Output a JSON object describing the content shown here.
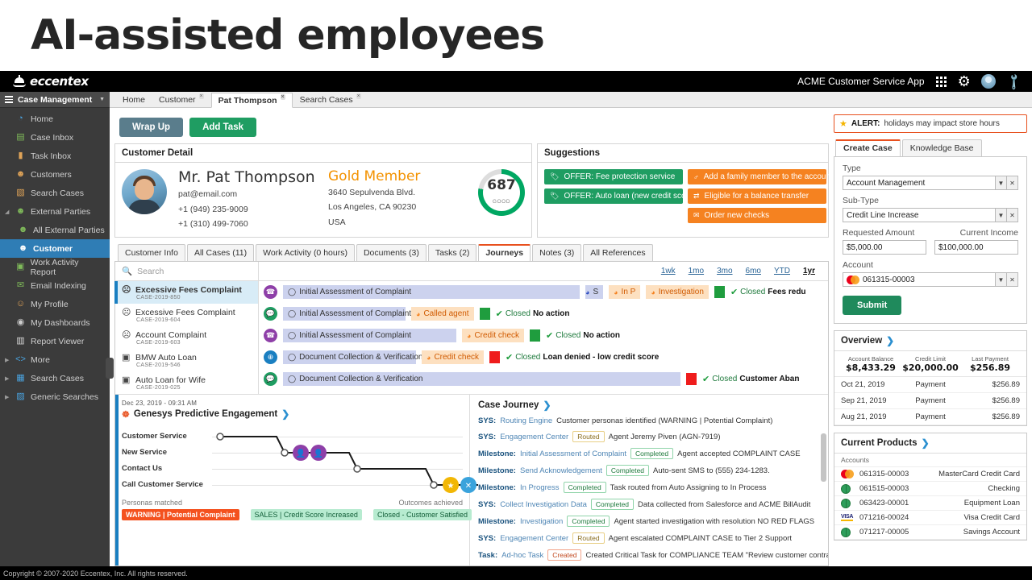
{
  "slide": {
    "title": "AI-assisted employees"
  },
  "topbar": {
    "brand": "eccentex",
    "app_name": "ACME Customer Service App",
    "icons": [
      "apps-grid-icon",
      "gear-icon",
      "avatar-icon",
      "wrench-icon"
    ]
  },
  "sidebar": {
    "header": "Case Management",
    "items": [
      {
        "label": "Home",
        "icon": "home-icon",
        "indent": false,
        "expander": "",
        "active": false
      },
      {
        "label": "Case Inbox",
        "icon": "case-inbox-icon",
        "indent": false,
        "expander": "",
        "active": false
      },
      {
        "label": "Task Inbox",
        "icon": "task-inbox-icon",
        "indent": false,
        "expander": "",
        "active": false
      },
      {
        "label": "Customers",
        "icon": "customers-icon",
        "indent": false,
        "expander": "",
        "active": false
      },
      {
        "label": "Search Cases",
        "icon": "search-cases-icon",
        "indent": false,
        "expander": "",
        "active": false
      },
      {
        "label": "External Parties",
        "icon": "external-parties-icon",
        "indent": false,
        "expander": "collapse-arrow",
        "active": false
      },
      {
        "label": "All External Parties",
        "icon": "external-party-icon",
        "indent": true,
        "expander": "",
        "active": false
      },
      {
        "label": "Customer",
        "icon": "customer-icon",
        "indent": true,
        "expander": "",
        "active": true
      },
      {
        "label": "Work Activity Report",
        "icon": "work-activity-icon",
        "indent": false,
        "expander": "",
        "active": false
      },
      {
        "label": "Email Indexing",
        "icon": "email-icon",
        "indent": false,
        "expander": "",
        "active": false
      },
      {
        "label": "My Profile",
        "icon": "profile-icon",
        "indent": false,
        "expander": "",
        "active": false
      },
      {
        "label": "My Dashboards",
        "icon": "dashboard-icon",
        "indent": false,
        "expander": "",
        "active": false
      },
      {
        "label": "Report Viewer",
        "icon": "report-icon",
        "indent": false,
        "expander": "",
        "active": false
      },
      {
        "label": "More",
        "icon": "code-icon",
        "indent": false,
        "expander": "expand-arrow",
        "active": false
      },
      {
        "label": "Search Cases",
        "icon": "grid-icon",
        "indent": false,
        "expander": "expand-arrow",
        "active": false
      },
      {
        "label": "Generic Searches",
        "icon": "generic-search-icon",
        "indent": false,
        "expander": "expand-arrow",
        "active": false
      }
    ]
  },
  "window_tabs": [
    {
      "label": "Home",
      "closable": false,
      "active": false
    },
    {
      "label": "Customer",
      "closable": true,
      "active": false
    },
    {
      "label": "Pat Thompson",
      "closable": true,
      "active": true
    },
    {
      "label": "Search Cases",
      "closable": true,
      "active": false
    }
  ],
  "actions": {
    "wrap_up": "Wrap Up",
    "add_task": "Add Task"
  },
  "customer_detail": {
    "panel_title": "Customer Detail",
    "name": "Mr. Pat Thompson",
    "email": "pat@email.com",
    "phone1": "+1 (949) 235-9009",
    "phone2": "+1 (310) 499-7060",
    "tier": "Gold Member",
    "address1": "3640 Sepulvenda Blvd.",
    "address2": "Los Angeles, CA 90230",
    "address3": "USA",
    "score": "687",
    "score_label": "GOOD"
  },
  "suggestions": {
    "panel_title": "Suggestions",
    "offers": [
      {
        "label": "OFFER: Fee protection service",
        "icon": "tag-icon"
      },
      {
        "label": "OFFER: Auto loan (new credit score)",
        "icon": "tag-icon"
      }
    ],
    "actions": [
      {
        "label": "Add a family member to the account",
        "icon": "family-icon"
      },
      {
        "label": "Eligible for a balance transfer",
        "icon": "transfer-icon"
      },
      {
        "label": "Order new checks",
        "icon": "envelope-icon"
      }
    ]
  },
  "customer_tabs": [
    {
      "label": "Customer Info",
      "active": false
    },
    {
      "label": "All Cases (11)",
      "active": false
    },
    {
      "label": "Work Activity (0 hours)",
      "active": false
    },
    {
      "label": "Documents (3)",
      "active": false
    },
    {
      "label": "Tasks (2)",
      "active": false
    },
    {
      "label": "Journeys",
      "active": true
    },
    {
      "label": "Notes (3)",
      "active": false
    },
    {
      "label": "All References",
      "active": false
    }
  ],
  "journey": {
    "search_placeholder": "Search",
    "ranges": [
      {
        "label": "1wk",
        "selected": false
      },
      {
        "label": "1mo",
        "selected": false
      },
      {
        "label": "3mo",
        "selected": false
      },
      {
        "label": "6mo",
        "selected": false
      },
      {
        "label": "YTD",
        "selected": false
      },
      {
        "label": "1yr",
        "selected": true
      }
    ],
    "cases": [
      {
        "title": "Excessive Fees Complaint",
        "id": "CASE-2019-850",
        "icon": "sad-face-icon",
        "selected": true
      },
      {
        "title": "Excessive Fees Complaint",
        "id": "CASE-2019-604",
        "icon": "sad-face-icon",
        "selected": false
      },
      {
        "title": "Account Complaint",
        "id": "CASE-2019-603",
        "icon": "sad-face-icon",
        "selected": false
      },
      {
        "title": "BMW Auto Loan",
        "id": "CASE-2019-546",
        "icon": "money-icon",
        "selected": false
      },
      {
        "title": "Auto Loan for Wife",
        "id": "CASE-2019-025",
        "icon": "money-icon",
        "selected": false
      }
    ],
    "tracks": [
      {
        "channel_icon": "phone-icon",
        "channel_color": "#8e3fa8",
        "stage": "Initial Assessment of Complaint",
        "stage_width": 368,
        "mid": [
          {
            "type": "blue-dot",
            "label": "S"
          },
          {
            "type": "peach",
            "label": "In P"
          },
          {
            "type": "peach",
            "label": "Investigation"
          }
        ],
        "square": "green",
        "closed_label": "Closed",
        "closed_value": "Fees redu"
      },
      {
        "channel_icon": "chat-icon",
        "channel_color": "#1f9d62",
        "stage": "Initial Assessment of Complaint",
        "stage_width": 152,
        "mid": [
          {
            "type": "peach",
            "label": "Called agent"
          }
        ],
        "square": "green",
        "closed_label": "Closed",
        "closed_value": "No action"
      },
      {
        "channel_icon": "phone-icon",
        "channel_color": "#8e3fa8",
        "stage": "Initial Assessment of Complaint",
        "stage_width": 215,
        "mid": [
          {
            "type": "peach",
            "label": "Credit check"
          }
        ],
        "square": "green",
        "closed_label": "Closed",
        "closed_value": "No action"
      },
      {
        "channel_icon": "web-icon",
        "channel_color": "#1a7fc1",
        "stage": "Document Collection & Verification",
        "stage_width": 165,
        "mid": [
          {
            "type": "peach",
            "label": "Credit check"
          }
        ],
        "square": "red",
        "closed_label": "Closed",
        "closed_value": "Loan denied - low credit score"
      },
      {
        "channel_icon": "chat-icon",
        "channel_color": "#1f9d62",
        "stage": "Document Collection & Verification",
        "stage_width": 493,
        "mid": [],
        "square": "red",
        "closed_label": "Closed",
        "closed_value": "Customer Aban"
      }
    ]
  },
  "genesys": {
    "date": "Dec 23, 2019 - 09:31 AM",
    "title": "Genesys Predictive Engagement",
    "rows": [
      "Customer Service",
      "New Service",
      "Contact Us",
      "Call Customer Service"
    ],
    "footer_left": "Personas matched",
    "footer_right": "Outcomes achieved",
    "tags": [
      {
        "label": "WARNING | Potential Complaint",
        "kind": "warn"
      },
      {
        "label": "SALES | Credit Score Increased",
        "kind": "sales"
      },
      {
        "label": "Closed - Customer Satisfied",
        "kind": "closed"
      }
    ]
  },
  "case_journey": {
    "title": "Case Journey",
    "entries": [
      {
        "key": "SYS:",
        "source": "Routing Engine",
        "status": "",
        "status_kind": "",
        "text": "Customer personas identified (WARNING | Potential Complaint)"
      },
      {
        "key": "SYS:",
        "source": "Engagement Center",
        "status": "Routed",
        "status_kind": "routed",
        "text": "Agent Jeremy Piven (AGN-7919)"
      },
      {
        "key": "Milestone:",
        "source": "Initial Assessment of Complaint",
        "status": "Completed",
        "status_kind": "completed",
        "text": "Agent accepted COMPLAINT CASE"
      },
      {
        "key": "Milestone:",
        "source": "Send Acknowledgement",
        "status": "Completed",
        "status_kind": "completed",
        "text": "Auto-sent SMS to (555) 234-1283."
      },
      {
        "key": "Milestone:",
        "source": "In Progress",
        "status": "Completed",
        "status_kind": "completed",
        "text": "Task routed from Auto Assigning to In Process"
      },
      {
        "key": "SYS:",
        "source": "Collect Investigation Data",
        "status": "Completed",
        "status_kind": "completed",
        "text": "Data collected from Salesforce and ACME BillAudit"
      },
      {
        "key": "Milestone:",
        "source": "Investigation",
        "status": "Completed",
        "status_kind": "completed",
        "text": "Agent started investigation with resolution NO RED FLAGS"
      },
      {
        "key": "SYS:",
        "source": "Engagement Center",
        "status": "Routed",
        "status_kind": "routed",
        "text": "Agent escalated COMPLAINT CASE to Tier 2 Support"
      },
      {
        "key": "Task:",
        "source": "Ad-hoc Task",
        "status": "Created",
        "status_kind": "created",
        "text": "Created Critical Task for COMPLIANCE TEAM \"Review customer contract\""
      }
    ]
  },
  "right_panel": {
    "alert_prefix": "ALERT:",
    "alert_text": "holidays may impact store hours",
    "tabs": [
      {
        "label": "Create Case",
        "active": true
      },
      {
        "label": "Knowledge Base",
        "active": false
      }
    ],
    "form": {
      "type_label": "Type",
      "type_value": "Account Management",
      "subtype_label": "Sub-Type",
      "subtype_value": "Credit Line Increase",
      "requested_label": "Requested Amount",
      "requested_value": "$5,000.00",
      "income_label": "Current Income",
      "income_value": "$100,000.00",
      "account_label": "Account",
      "account_value": "061315-00003",
      "submit_label": "Submit"
    },
    "overview": {
      "title": "Overview",
      "summary": [
        {
          "key": "Account Balance",
          "value": "$8,433.29"
        },
        {
          "key": "Credit Limit",
          "value": "$20,000.00"
        },
        {
          "key": "Last Payment",
          "value": "$256.89"
        }
      ],
      "rows": [
        {
          "date": "Oct 21, 2019",
          "type": "Payment",
          "amount": "$256.89"
        },
        {
          "date": "Sep 21, 2019",
          "type": "Payment",
          "amount": "$256.89"
        },
        {
          "date": "Aug 21, 2019",
          "type": "Payment",
          "amount": "$256.89"
        }
      ]
    },
    "products": {
      "title": "Current Products",
      "group_label": "Accounts",
      "rows": [
        {
          "number": "061315-00003",
          "name": "MasterCard Credit Card",
          "icon": "mastercard-icon"
        },
        {
          "number": "061515-00003",
          "name": "Checking",
          "icon": "globe-icon"
        },
        {
          "number": "063423-00001",
          "name": "Equipment Loan",
          "icon": "globe-icon"
        },
        {
          "number": "071216-00024",
          "name": "Visa Credit Card",
          "icon": "visa-icon"
        },
        {
          "number": "071217-00005",
          "name": "Savings Account",
          "icon": "globe-icon"
        }
      ]
    }
  },
  "footer": {
    "copyright": "Copyright © 2007-2020 Eccentex, Inc. All rights reserved."
  }
}
